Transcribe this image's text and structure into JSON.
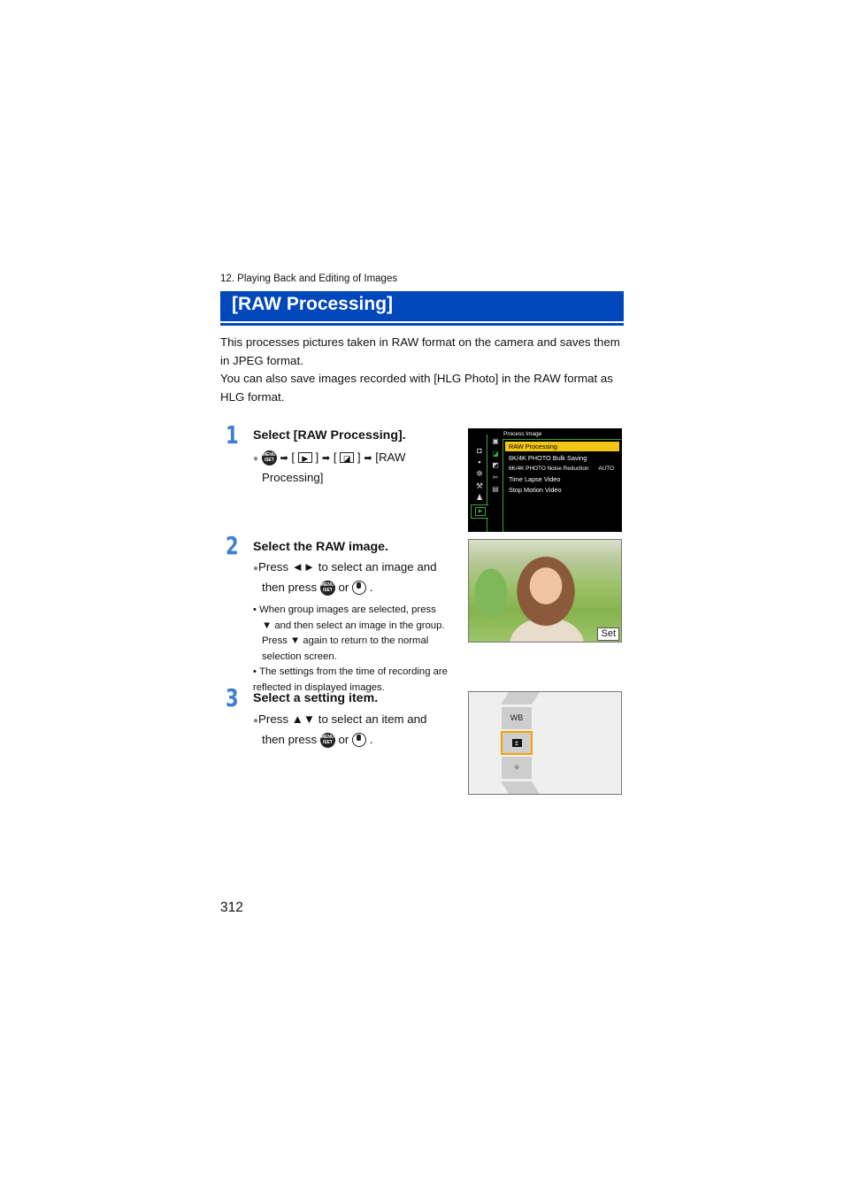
{
  "chapter": "12. Playing Back and Editing of Images",
  "title": "[RAW Processing]",
  "colors": {
    "title_bar": "#0047bb",
    "step_number": "#3f7fd4",
    "menu_highlight": "#f2c615",
    "menu_green": "#3ba33b",
    "selection_outline": "#f5a400"
  },
  "intro": [
    "This processes pictures taken in RAW format on the camera and saves them in JPEG format.",
    "You can also save images recorded with [HLG Photo] in the RAW format as HLG format."
  ],
  "steps": [
    {
      "number": "1",
      "title": "Select [RAW Processing].",
      "path": {
        "menu_icon": "menu-set-button-icon",
        "arrow": "➡",
        "tab_icon": "playback-tab-icon",
        "subtab_icon": "process-image-icon",
        "open_bracket": "[",
        "close_bracket": "]",
        "final_a": "[RAW",
        "final_b": "Processing]"
      }
    },
    {
      "number": "2",
      "title": "Select the RAW image.",
      "line1": "Press ◄► to select an image and",
      "line2_a": "then press",
      "line2_or": "or",
      "line2_end": ".",
      "notes": [
        "When group images are selected, press",
        "▼ and then select an image in the group.",
        "Press ▼ again to return to the normal",
        "selection screen."
      ],
      "note2": "The settings from the time of recording are reflected in displayed images."
    },
    {
      "number": "3",
      "title": "Select a setting item.",
      "line1": "Press ▲▼ to select an item and",
      "line2_a": "then press",
      "line2_or": "or",
      "line2_end": "."
    }
  ],
  "camera_menu": {
    "heading": "Process Image",
    "items": [
      {
        "label": "RAW Processing",
        "value": "",
        "selected": true
      },
      {
        "label": "6K/4K PHOTO Bulk Saving",
        "value": "",
        "selected": false
      },
      {
        "label": "6K/4K PHOTO Noise Reduction",
        "value": "AUTO",
        "selected": false
      },
      {
        "label": "Time Lapse Video",
        "value": "",
        "selected": false
      },
      {
        "label": "Stop Motion Video",
        "value": "",
        "selected": false
      }
    ],
    "left_tabs": [
      "camera-icon",
      "video-icon",
      "gear-icon",
      "wrench-icon",
      "person-icon",
      "playback-icon"
    ],
    "sub_tabs": [
      "slideshow-icon",
      "process-image-icon",
      "edit-image-icon",
      "cut-icon",
      "playback-settings-icon"
    ]
  },
  "photo_screen": {
    "set_label": "Set"
  },
  "settings_screen": {
    "items": [
      {
        "label": "WB",
        "selected": false
      },
      {
        "label": "±",
        "icon": "exposure-compensation-icon",
        "selected": true
      },
      {
        "label": "✧",
        "icon": "brightness-icon",
        "selected": false
      }
    ]
  },
  "page_number": "312"
}
